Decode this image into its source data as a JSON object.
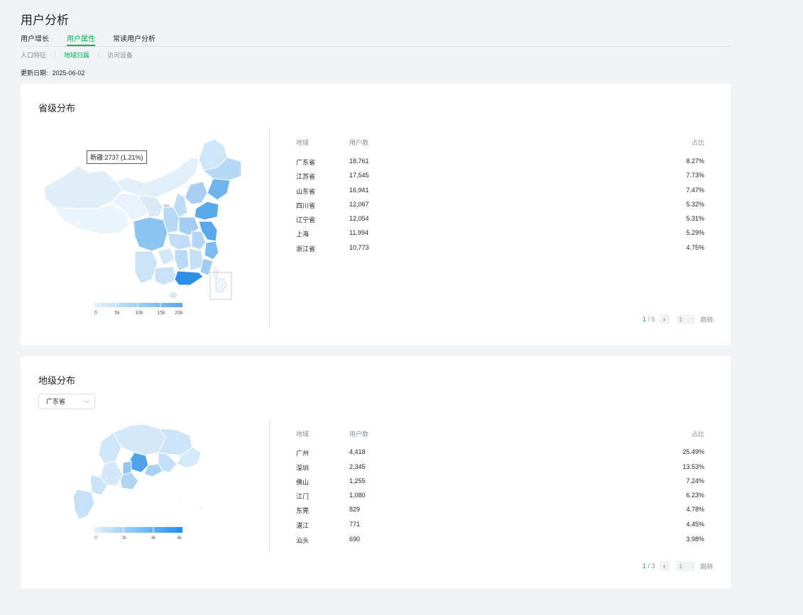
{
  "page": {
    "title": "用户分析"
  },
  "tabs": [
    {
      "label": "用户增长",
      "active": false
    },
    {
      "label": "用户属性",
      "active": true
    },
    {
      "label": "常读用户分析",
      "active": false
    }
  ],
  "subtabs": [
    {
      "label": "人口特征",
      "active": false
    },
    {
      "label": "地域归属",
      "active": true
    },
    {
      "label": "访问设备",
      "active": false
    }
  ],
  "update": {
    "label": "更新日期:",
    "value": "2025-06-02"
  },
  "province": {
    "title": "省级分布",
    "tooltip": "新疆:2737 (1.21%)",
    "legend_ticks": [
      "0",
      "5k",
      "10k",
      "15k",
      "20k"
    ],
    "headers": [
      "地域",
      "用户数",
      "占比"
    ],
    "rows": [
      [
        "广东省",
        "18,761",
        "8.27%"
      ],
      [
        "江苏省",
        "17,545",
        "7.73%"
      ],
      [
        "山东省",
        "16,941",
        "7.47%"
      ],
      [
        "四川省",
        "12,067",
        "5.32%"
      ],
      [
        "辽宁省",
        "12,054",
        "5.31%"
      ],
      [
        "上海",
        "11,994",
        "5.29%"
      ],
      [
        "浙江省",
        "10,773",
        "4.75%"
      ]
    ],
    "pager": {
      "current": "1",
      "total": "/ 5",
      "input": "1",
      "jump": "跳转"
    }
  },
  "city": {
    "title": "地级分布",
    "select": "广东省",
    "legend_ticks": [
      "0",
      "2k",
      "4k",
      "6k"
    ],
    "headers": [
      "地域",
      "用户数",
      "占比"
    ],
    "rows": [
      [
        "广州",
        "4,418",
        "25.49%"
      ],
      [
        "深圳",
        "2,345",
        "13.53%"
      ],
      [
        "佛山",
        "1,255",
        "7.24%"
      ],
      [
        "江门",
        "1,080",
        "6.23%"
      ],
      [
        "东莞",
        "829",
        "4.78%"
      ],
      [
        "湛江",
        "771",
        "4.45%"
      ],
      [
        "汕头",
        "690",
        "3.98%"
      ]
    ],
    "pager": {
      "current": "1",
      "total": "/ 3",
      "input": "1",
      "jump": "跳转"
    }
  },
  "colors": {
    "accent": "#00b259",
    "map_high": "#1890ff",
    "map_low": "#e6f2fd"
  }
}
